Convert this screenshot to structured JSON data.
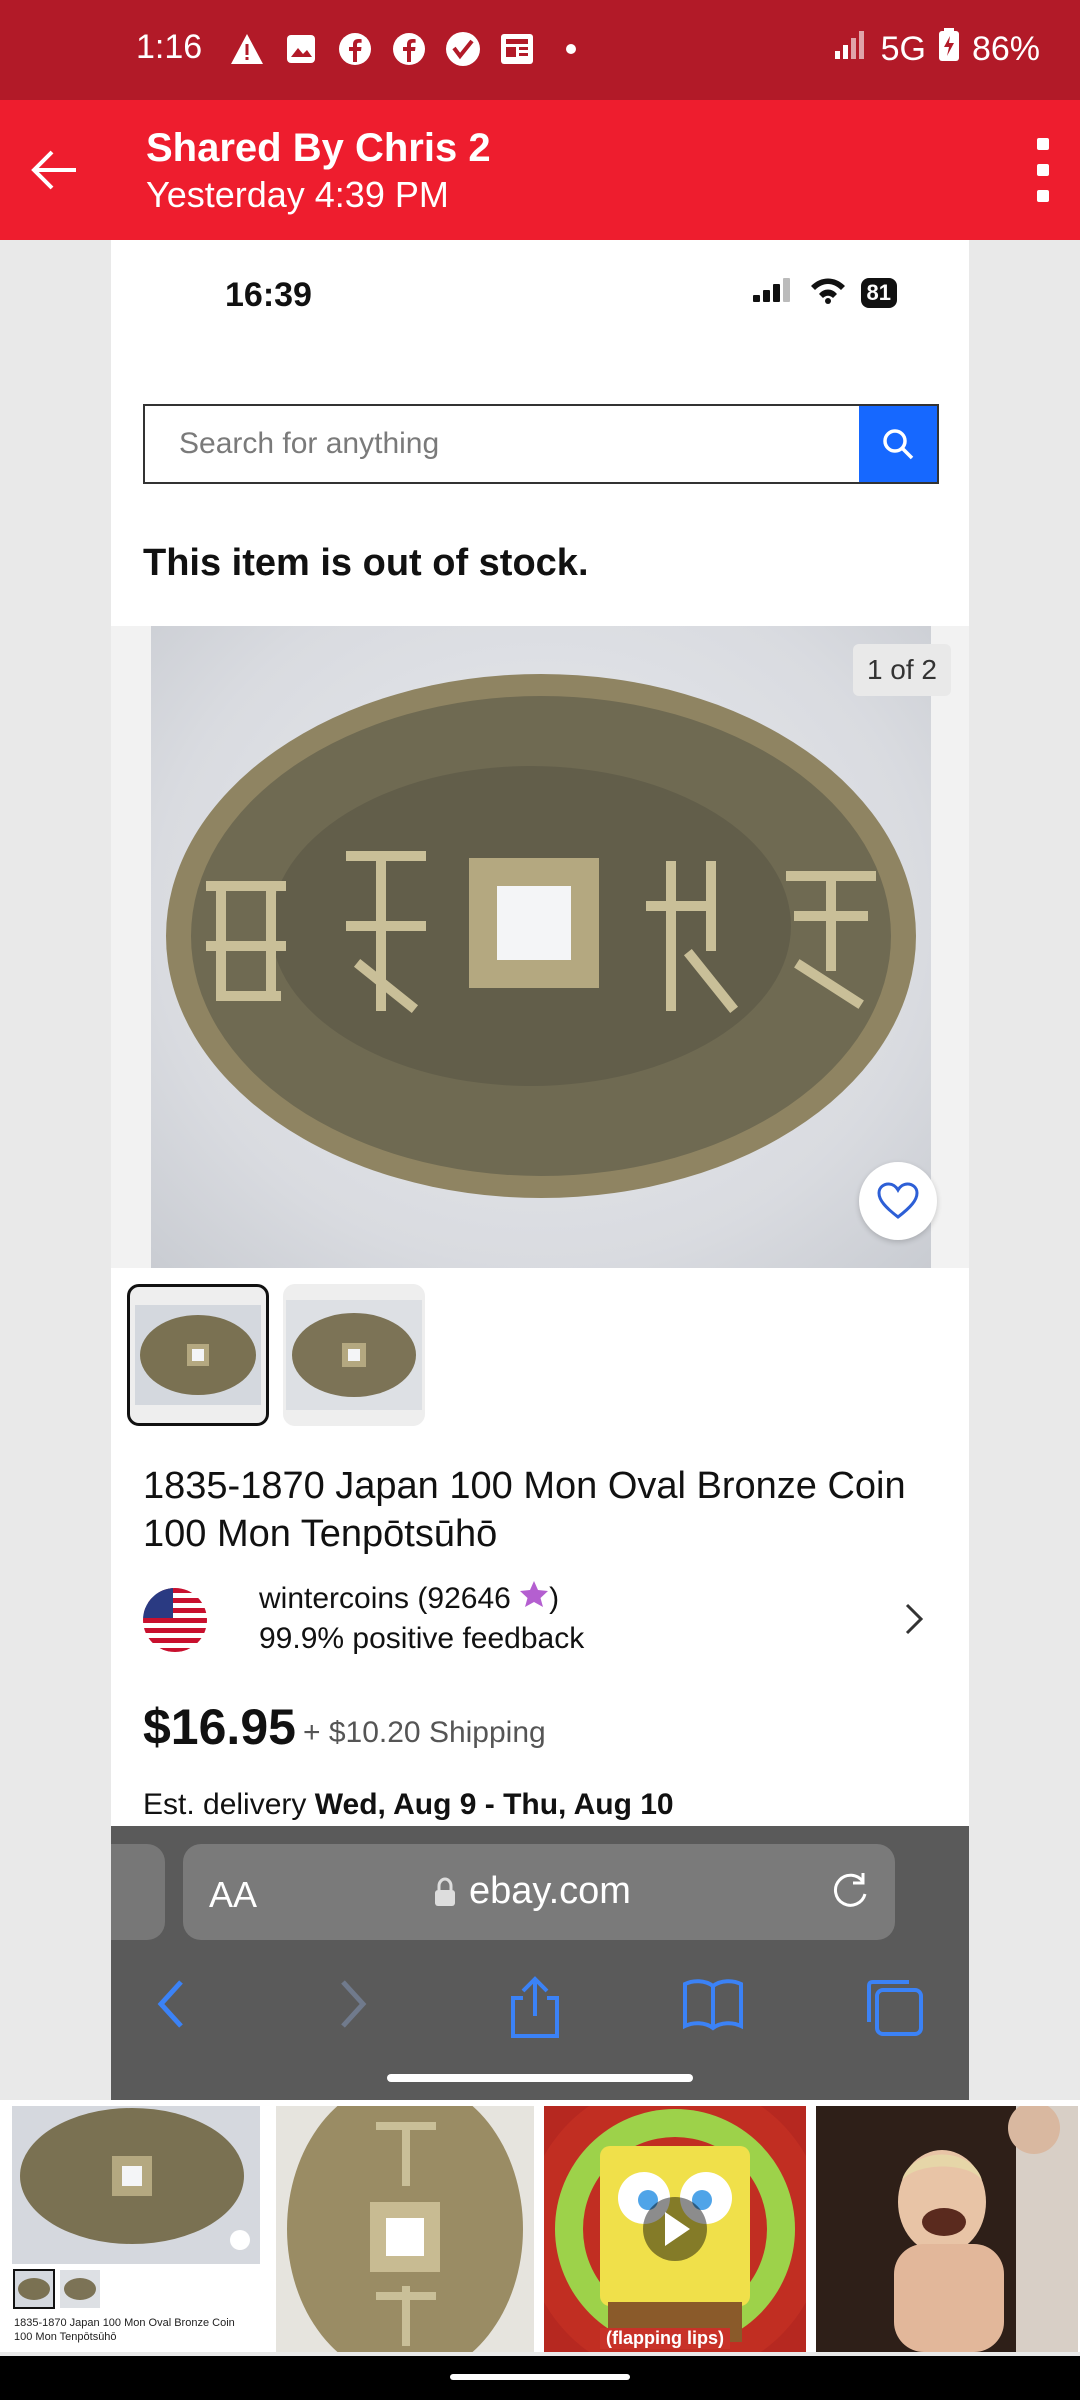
{
  "android_status": {
    "time": "1:16",
    "network": "5G",
    "battery": "86%",
    "icons": [
      "warning-icon",
      "image-icon",
      "facebook-icon",
      "facebook-icon",
      "check-badge-icon",
      "news-icon",
      "dot-icon",
      "signal-icon",
      "battery-charging-icon"
    ]
  },
  "share_header": {
    "title": "Shared By Chris 2",
    "subtitle": "Yesterday 4:39 PM"
  },
  "screenshot": {
    "ios_status": {
      "time": "16:39",
      "battery": "81"
    },
    "search": {
      "placeholder": "Search for anything"
    },
    "out_of_stock": "This item is out of stock.",
    "gallery": {
      "counter": "1 of 2"
    },
    "item": {
      "title": "1835-1870 Japan 100 Mon Oval Bronze Coin 100 Mon Tenpōtsūhō",
      "seller_name": "wintercoins (92646",
      "seller_name_suffix": ")",
      "seller_feedback": "99.9% positive feedback",
      "price": "$16.95",
      "shipping": "+ $10.20 Shipping",
      "delivery_label": "Est. delivery",
      "delivery_dates": "Wed, Aug 9 - Thu, Aug 10"
    },
    "safari": {
      "text_size_label": "AA",
      "domain": "ebay.com"
    }
  },
  "media_strip": {
    "caption": "1835-1870 Japan 100 Mon Oval Bronze Coin 100 Mon Tenpōtsūhō",
    "gif_label": "(flapping lips)"
  },
  "colors": {
    "status_bar": "#b21a28",
    "header": "#ee1d2e",
    "search_button": "#1668ff",
    "safari_bar": "#5a5a5a",
    "safari_icons": "#3b82f6"
  }
}
